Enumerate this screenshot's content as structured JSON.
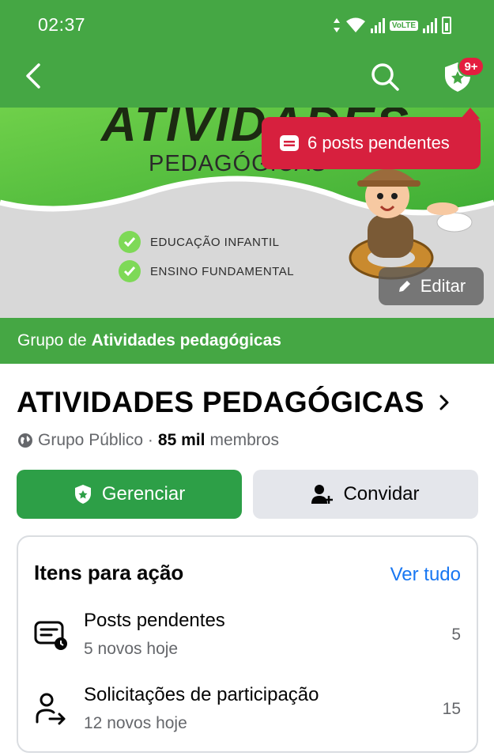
{
  "status_bar": {
    "time": "02:37",
    "network_label": "VoLTE",
    "icons": [
      "data-arrows-icon",
      "wifi-icon",
      "signal-icon",
      "volte-icon",
      "signal-icon",
      "battery-icon"
    ]
  },
  "app_bar": {
    "notification_badge": "9+",
    "icons": [
      "back-arrow-icon",
      "search-icon",
      "shield-star-icon"
    ]
  },
  "tooltip": {
    "text": "6 posts pendentes",
    "color": "#d7203e"
  },
  "cover": {
    "title": "ATIVIDADES",
    "subtitle": "PEDAGÓGICAS",
    "checks": [
      "EDUCAÇÃO INFANTIL",
      "ENSINO FUNDAMENTAL"
    ],
    "edit_label": "Editar"
  },
  "group_strip": {
    "prefix": "Grupo de",
    "name": "Atividades pedagógicas"
  },
  "group": {
    "name": "ATIVIDADES PEDAGÓGICAS",
    "privacy": "Grupo Público ·",
    "members_count": "85 mil",
    "members_label": "membros"
  },
  "actions": {
    "manage_label": "Gerenciar",
    "invite_label": "Convidar"
  },
  "action_card": {
    "title": "Itens para ação",
    "see_all": "Ver tudo",
    "items": [
      {
        "title": "Posts pendentes",
        "subtitle": "5 novos hoje",
        "count": "5",
        "icon": "pending-posts-icon"
      },
      {
        "title": "Solicitações de participação",
        "subtitle": "12 novos hoje",
        "count": "15",
        "icon": "member-request-icon"
      }
    ]
  },
  "colors": {
    "brand_green": "#45a744",
    "button_green": "#2d9f47",
    "link_blue": "#1877f2",
    "badge_red": "#e41e3f"
  }
}
